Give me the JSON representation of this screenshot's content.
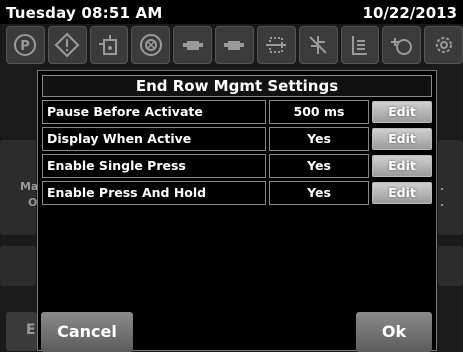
{
  "status": {
    "day_time": "Tuesday 08:51 AM",
    "date": "10/22/2013"
  },
  "icons": [
    "parking-brake-icon",
    "warning-triangle-icon",
    "hydraulic-oil-icon",
    "clutch-icon",
    "engine-oil-icon",
    "oil-pressure-icon",
    "radiator-fluid-icon",
    "coolant-level-icon",
    "transmission-fluid-icon",
    "fuel-filter-icon",
    "air-filter-icon"
  ],
  "background": {
    "left_fragment_1": "Ma",
    "left_fragment_2": "O",
    "right_fragment_1": ".",
    "right_fragment_2": ".",
    "bottom_left_letter": "E"
  },
  "dialog": {
    "title": "End Row Mgmt Settings",
    "rows": [
      {
        "label": "Pause Before Activate",
        "value": "500 ms",
        "edit": "Edit"
      },
      {
        "label": "Display When Active",
        "value": "Yes",
        "edit": "Edit"
      },
      {
        "label": "Enable Single Press",
        "value": "Yes",
        "edit": "Edit"
      },
      {
        "label": "Enable Press And Hold",
        "value": "Yes",
        "edit": "Edit"
      }
    ],
    "cancel": "Cancel",
    "ok": "Ok"
  }
}
